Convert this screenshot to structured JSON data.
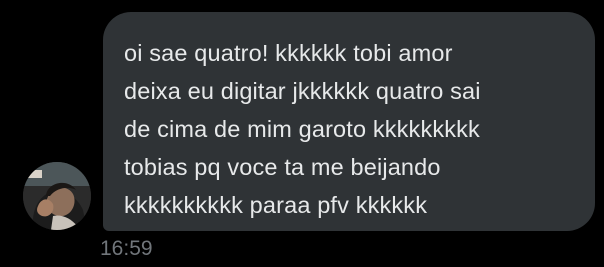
{
  "message": {
    "lines": [
      "oi sae quatro! kkkkkk tobi amor",
      "deixa eu digitar jkkkkkk quatro sai",
      "de cima de mim garoto kkkkkkkkk",
      "tobias pq voce ta me beijando",
      "kkkkkkkkkk paraa pfv kkkkkk"
    ],
    "timestamp": "16:59"
  },
  "colors": {
    "background": "#000000",
    "bubble": "#2f3336",
    "text": "#e7e9ea",
    "timestamp": "#71767b"
  }
}
